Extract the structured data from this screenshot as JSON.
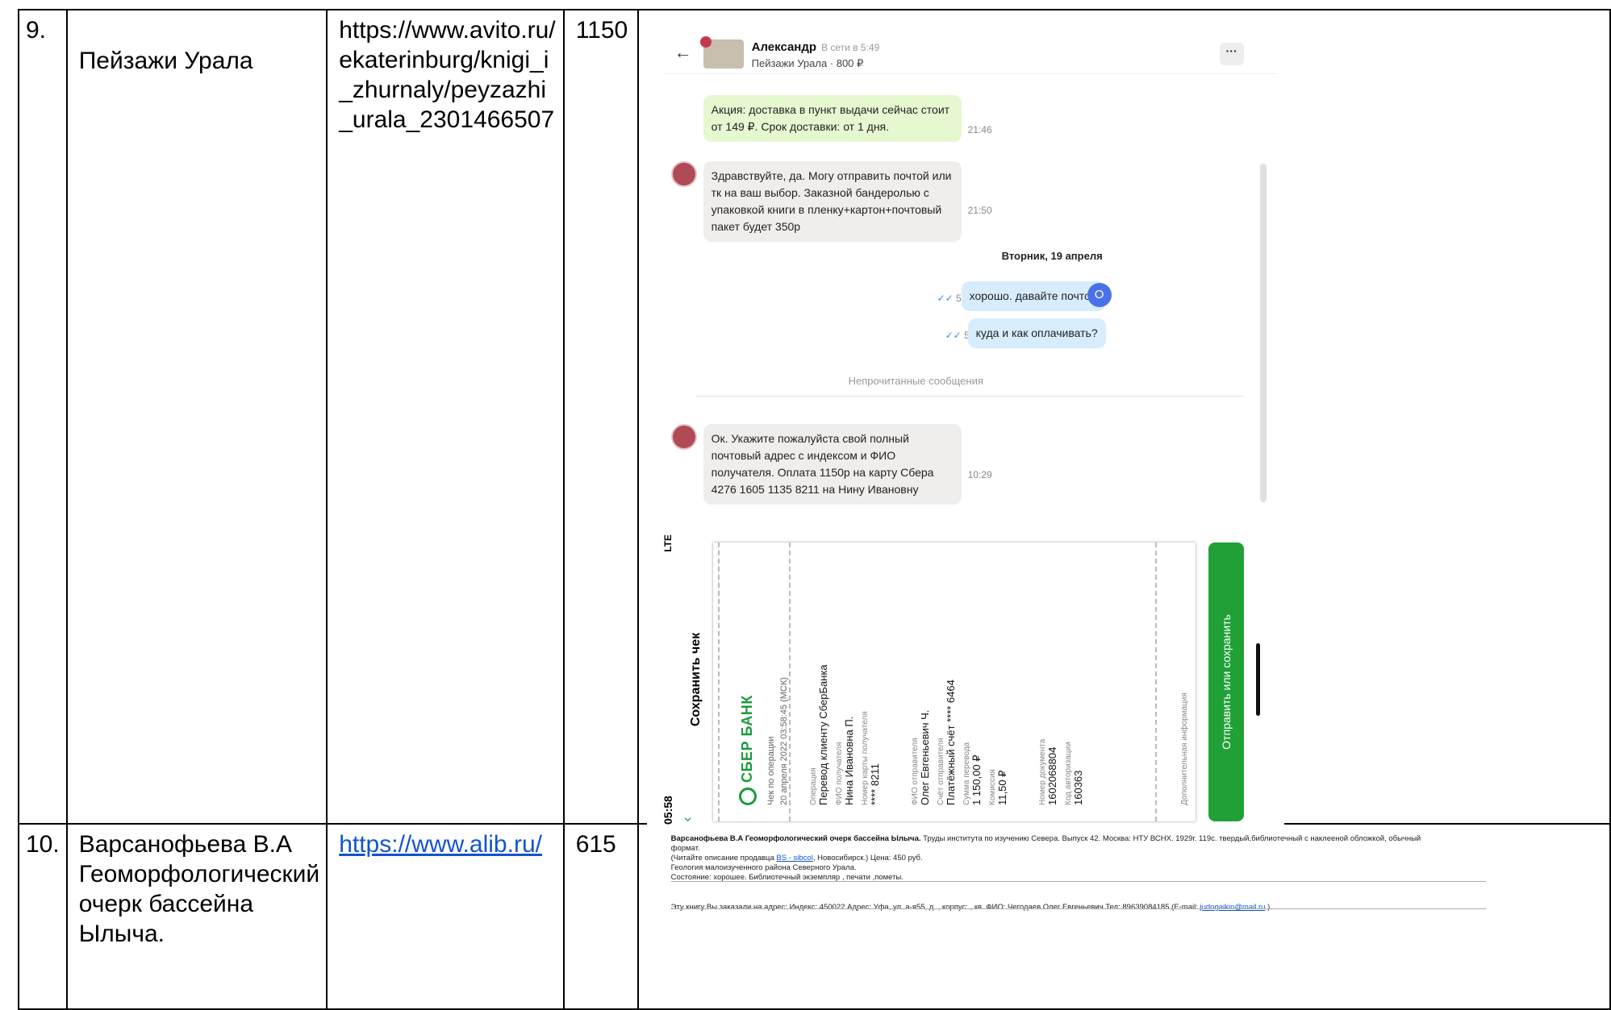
{
  "rows": [
    {
      "num": "9.",
      "title": "Пейзажи Урала",
      "url": "https://www.avito.ru/ekaterinburg/knigi_i_zhurnaly/peyzazhi_urala_2301466507",
      "price": "1150"
    },
    {
      "num": "10.",
      "title": "Варсанофьева В.А Геоморфологический очерк бассейна Ылыча.",
      "url": "https://www.alib.ru/",
      "price": "615"
    }
  ],
  "chat": {
    "back_icon": "←",
    "seller_name": "Александр",
    "seller_status": "В сети в 5:49",
    "item": "Пейзажи Урала · 800 ₽",
    "more_icon": "···",
    "messages": [
      {
        "text": "Акция: доставка в пункт выдачи сейчас стоит от 149 ₽. Срок доставки: от 1 дня.",
        "time": "21:46"
      },
      {
        "text": "Здравствуйте, да. Могу отправить почтой или тк на ваш выбор. Заказной бандеролью с упаковкой книги в пленку+картон+почтовый пакет будет 350р",
        "time": "21:50"
      },
      {
        "text": "хорошо. давайте почтой",
        "time": "5:39"
      },
      {
        "text": "куда и как оплачивать?",
        "time": "5:39"
      },
      {
        "text": "Ок. Укажите пожалуйста свой полный почтовый адрес с индексом и ФИО получателя. Оплата 1150р на карту Сбера 4276 1605 1135 8211 на Нину Ивановну",
        "time": "10:29"
      }
    ],
    "date_separator": "Вторник, 19 апреля",
    "unread_label": "Непрочитанные сообщения",
    "my_avatar": "О",
    "check_icon": "✓✓"
  },
  "receipt": {
    "status_time": "05:58",
    "signal": "LTE",
    "title": "Сохранить чек",
    "bank": "СБЕР БАНК",
    "subtitle": "Чек по операции",
    "datetime": "20 апреля 2022 03:58:45 (МСК)",
    "fields": [
      {
        "label": "Операция",
        "value": "Перевод клиенту СберБанка"
      },
      {
        "label": "ФИО получателя",
        "value": "Нина Ивановна П."
      },
      {
        "label": "Номер карты получателя",
        "value": "**** 8211"
      },
      {
        "label": "ФИО отправителя",
        "value": "Олег Евгеньевич Ч."
      },
      {
        "label": "Счёт отправителя",
        "value": "Платёжный счёт **** 6464"
      },
      {
        "label": "Сумма перевода",
        "value": "1 150,00 ₽"
      },
      {
        "label": "Комиссия",
        "value": "11,50 ₽"
      },
      {
        "label": "Номер документа",
        "value": "1602068804"
      },
      {
        "label": "Код авторизации",
        "value": "160363"
      }
    ],
    "extra_label": "Дополнительная информация",
    "button": "Отправить или сохранить",
    "chevron_icon": "›"
  },
  "alib": {
    "bold_title": "Варсанофьева В.А Геоморфологический очерк бассейна Ылыча.",
    "desc": " Труды института по изучению Севера. Выпуск 42. Москва: НТУ ВСНХ. 1929г. 119с. твердый,библиотечный с наклееной обложкой, обычный формат.",
    "seller_prefix": "(Читайте описание продавца ",
    "seller_link": "BS - sibcol",
    "seller_suffix": ", Новосибирск.) Цена: 450 руб.",
    "geo": "Геология малоизученного района Северного Урала.",
    "state": "Состояние: хорошее. Библиотечный экземпляр , печати ,пометы.",
    "order_prefix": "Эту книгу Вы заказали на адрес: Индекс: 450022 Адрес: Уфа, ул. а-я55, д. , корпус: , кв. ФИО: Чегодаев Олег Евгеньевич Тел: 89639084185 (E-mail: ",
    "order_email": "judogaikin@mail.ru",
    "order_suffix": " )"
  }
}
